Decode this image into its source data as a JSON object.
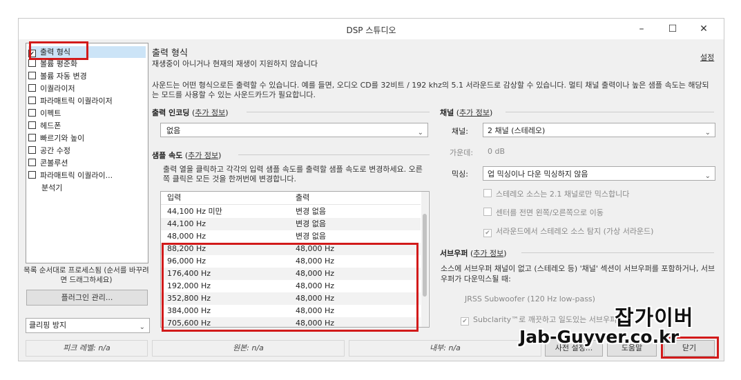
{
  "window": {
    "title": "DSP 스튜디오",
    "minimize": "–",
    "maximize": "☐",
    "close": "✕"
  },
  "sidebar": {
    "items": [
      {
        "label": "출력 형식",
        "checked": true
      },
      {
        "label": "볼륨 평준화",
        "checked": false
      },
      {
        "label": "볼륨 자동 변경",
        "checked": false
      },
      {
        "label": "이퀄라이저",
        "checked": false
      },
      {
        "label": "파라매트릭 이퀄라이저",
        "checked": false
      },
      {
        "label": "이펙트",
        "checked": false
      },
      {
        "label": "헤드폰",
        "checked": false
      },
      {
        "label": "빠르기와 높이",
        "checked": false
      },
      {
        "label": "공간 수정",
        "checked": false
      },
      {
        "label": "콘볼루션",
        "checked": false
      },
      {
        "label": "파라매트릭 이퀄라이...",
        "checked": false
      },
      {
        "label": "분석기",
        "checked": null
      }
    ],
    "hint": "목록 순서대로 프로세스됨 (순서를 바꾸려면 드래그하세요)",
    "plugin_button": "플러그인 관리...",
    "clip_select": "클리핑 방지"
  },
  "main": {
    "heading": "출력 형식",
    "subheading": "재생중이 아니거나 현재의 재생이 지원하지 않습니다",
    "settings_link": "설정",
    "description": "사운드는 어떤 형식으로든 출력할 수 있습니다. 예를 들면, 오디오 CD를 32비트 / 192 khz의 5.1 서라운드로 감상할 수 있습니다.  멀티 채널 출력이나 높은 샘플 속도는 해당되는 모드를 사용할 수 있는 사운드카드가 필요합니다.",
    "encoding": {
      "label": "출력 인코딩",
      "more": "추가 정보",
      "value": "없음"
    },
    "samplerate": {
      "label": "샘플 속도",
      "more": "추가 정보",
      "instructions": "출력 열을 클릭하고 각각의 입력 샘플 속도를 출력할 샘플 속도로 변경하세요. 오른쪽 클릭은 모든 것을 한꺼번에 변경합니다.",
      "col_input": "입력",
      "col_output": "출력",
      "rows": [
        {
          "in": "44,100 Hz 미만",
          "out": "변경 없음"
        },
        {
          "in": "44,100 Hz",
          "out": "변경 없음"
        },
        {
          "in": "48,000 Hz",
          "out": "변경 없음"
        },
        {
          "in": "88,200 Hz",
          "out": "48,000 Hz"
        },
        {
          "in": "96,000 Hz",
          "out": "48,000 Hz"
        },
        {
          "in": "176,400 Hz",
          "out": "48,000 Hz"
        },
        {
          "in": "192,000 Hz",
          "out": "48,000 Hz"
        },
        {
          "in": "352,800 Hz",
          "out": "48,000 Hz"
        },
        {
          "in": "384,000 Hz",
          "out": "48,000 Hz"
        },
        {
          "in": "705,600 Hz",
          "out": "48,000 Hz"
        }
      ]
    },
    "channels": {
      "label": "채널",
      "more": "추가 정보",
      "channel_label": "채널:",
      "channel_value": "2 채널 (스테레오)",
      "gain_label": "가운데:",
      "gain_value": "0 dB",
      "mix_label": "믹싱:",
      "mix_value": "업 믹싱이나 다운 믹싱하지 않음",
      "opt1": "스테레오 소스는 2.1 채널로만 믹스합니다",
      "opt2": "센터를 전면 왼쪽/오른쪽으로 이동",
      "opt3": "서라운드에서 스테레오 소스 탐지 (가상 서라운드)"
    },
    "subwoofer": {
      "label": "서브우퍼",
      "more": "추가 정보",
      "desc": "소스에 서브우퍼 채널이 없고 (스테레오 등) '채널' 섹션이 서브우퍼를 포함하거나, 서브우퍼가 다운믹스될 때:",
      "filter": "JRSS Subwoofer (120 Hz low-pass)",
      "subclarity": "Subclarity™로 깨끗하고 일도있는 서브우퍼"
    }
  },
  "statusbar": {
    "peak": "피크 레벨: n/a",
    "source": "원본: n/a",
    "internal": "내부: n/a"
  },
  "footer": {
    "preset_button": "사전 설정...",
    "help_button": "도움말",
    "close_button": "닫기"
  },
  "watermark": {
    "korean": "잡가이버",
    "latin": "Jab-Guyver.co.kr"
  }
}
